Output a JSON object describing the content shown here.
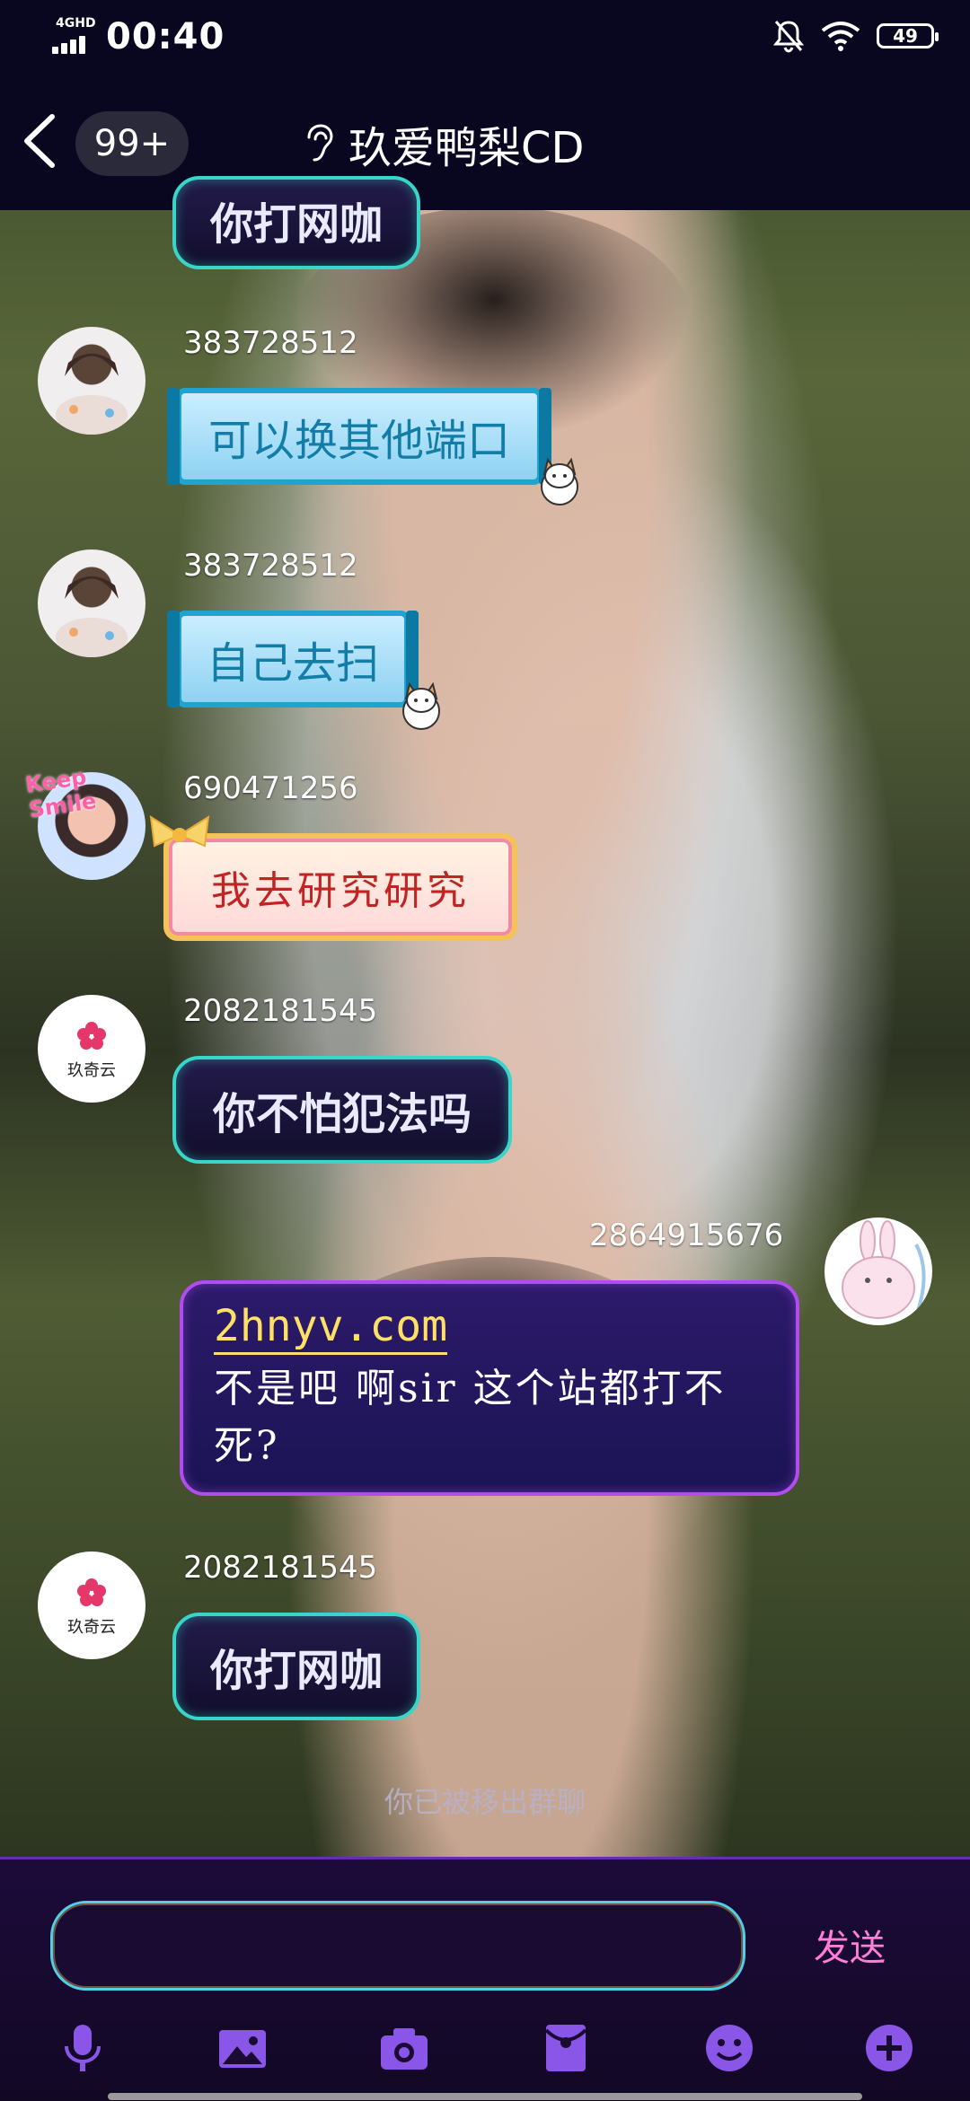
{
  "status_bar": {
    "network": "4GHD",
    "time": "00:40",
    "battery": "49"
  },
  "header": {
    "unread_badge": "99+",
    "title": "玖爱鸭梨CD"
  },
  "messages": [
    {
      "uid": "",
      "text": "你打网咖"
    },
    {
      "uid": "383728512",
      "text": "可以换其他端口"
    },
    {
      "uid": "383728512",
      "text": "自己去扫"
    },
    {
      "uid": "690471256",
      "text": "我去研究研究",
      "avatar_text": "Keep Smile"
    },
    {
      "uid": "2082181545",
      "text": "你不怕犯法吗",
      "avatar_text": "玖奇云"
    },
    {
      "uid": "2864915676",
      "link": "2hnyv.com",
      "text": "不是吧 啊sir 这个站都打不死?"
    },
    {
      "uid": "2082181545",
      "text": "你打网咖",
      "avatar_text": "玖奇云"
    }
  ],
  "system_note": "你已被移出群聊",
  "composer": {
    "input_value": "",
    "send_label": "发送"
  },
  "toolbar": {
    "icons": [
      "microphone-icon",
      "image-icon",
      "camera-icon",
      "red-packet-icon",
      "emoji-icon",
      "plus-icon"
    ],
    "color": "#8a56e8"
  }
}
